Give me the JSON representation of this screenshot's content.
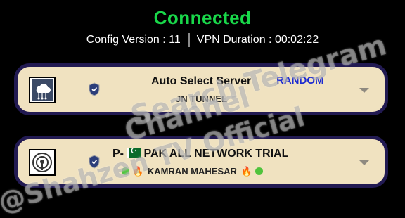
{
  "status": {
    "title": "Connected",
    "title_color": "#19d84a"
  },
  "info": {
    "config_version": "Config Version : 11",
    "vpn_duration": "VPN Duration : 00:02:22"
  },
  "server_card": {
    "icon": "cloud-server-icon",
    "title": "Auto Select Server",
    "subtitle": "JN TUNNEL",
    "mode": "RANDOM",
    "mode_color": "#1d2bd0"
  },
  "network_card": {
    "icon": "broadcast-icon",
    "title_prefix": "P-",
    "title": "PAK ALL NETWORK TRIAL",
    "subtitle": "KAMRAN MAHESAR"
  },
  "watermark": {
    "line1": "Search Telegram",
    "line2": "Channel",
    "line3": "@Shahzen TV Official"
  }
}
